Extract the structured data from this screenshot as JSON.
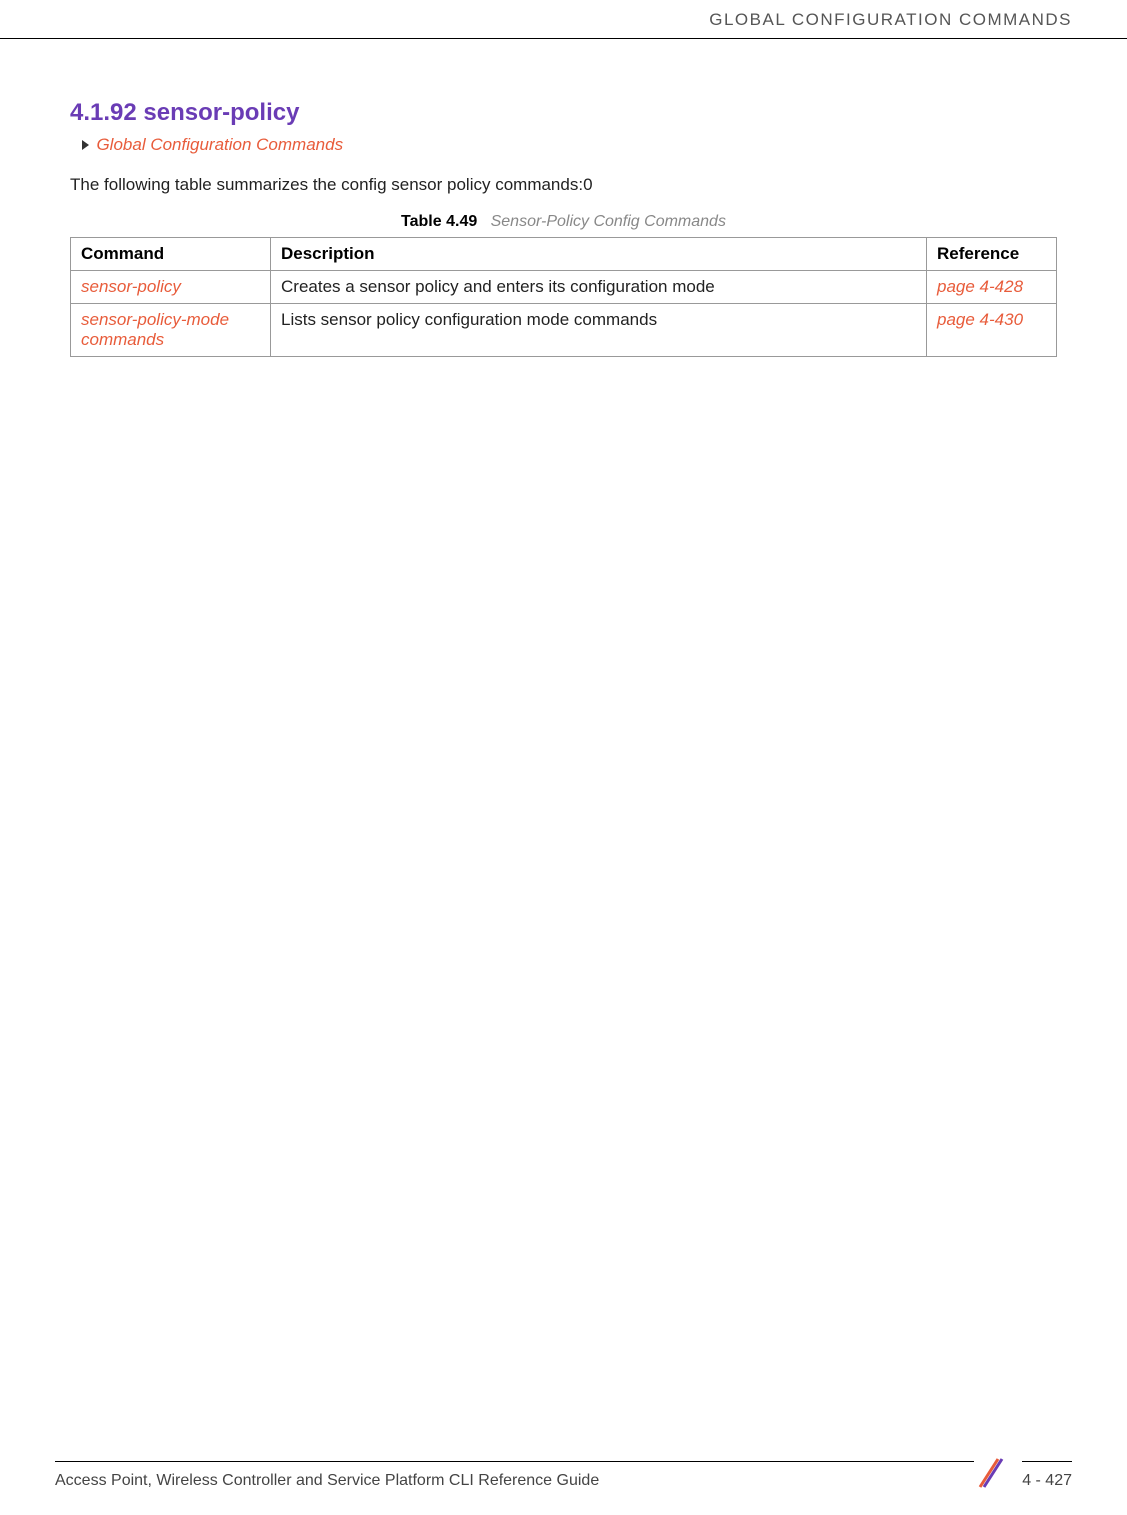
{
  "header": {
    "title": "GLOBAL CONFIGURATION COMMANDS"
  },
  "section": {
    "heading": "4.1.92 sensor-policy",
    "breadcrumb": "Global Configuration Commands",
    "intro": "The following table summarizes the config sensor policy commands:0"
  },
  "table": {
    "caption_label": "Table 4.49",
    "caption_title": "Sensor-Policy Config Commands",
    "headers": {
      "command": "Command",
      "description": "Description",
      "reference": "Reference"
    },
    "rows": [
      {
        "command": "sensor-policy",
        "description": "Creates a sensor policy and enters its configuration mode",
        "reference": "page 4-428"
      },
      {
        "command": "sensor-policy-mode commands",
        "description": "Lists sensor policy configuration mode commands",
        "reference": "page 4-430"
      }
    ]
  },
  "footer": {
    "guide_title": "Access Point, Wireless Controller and Service Platform CLI Reference Guide",
    "page_number": "4 - 427"
  }
}
